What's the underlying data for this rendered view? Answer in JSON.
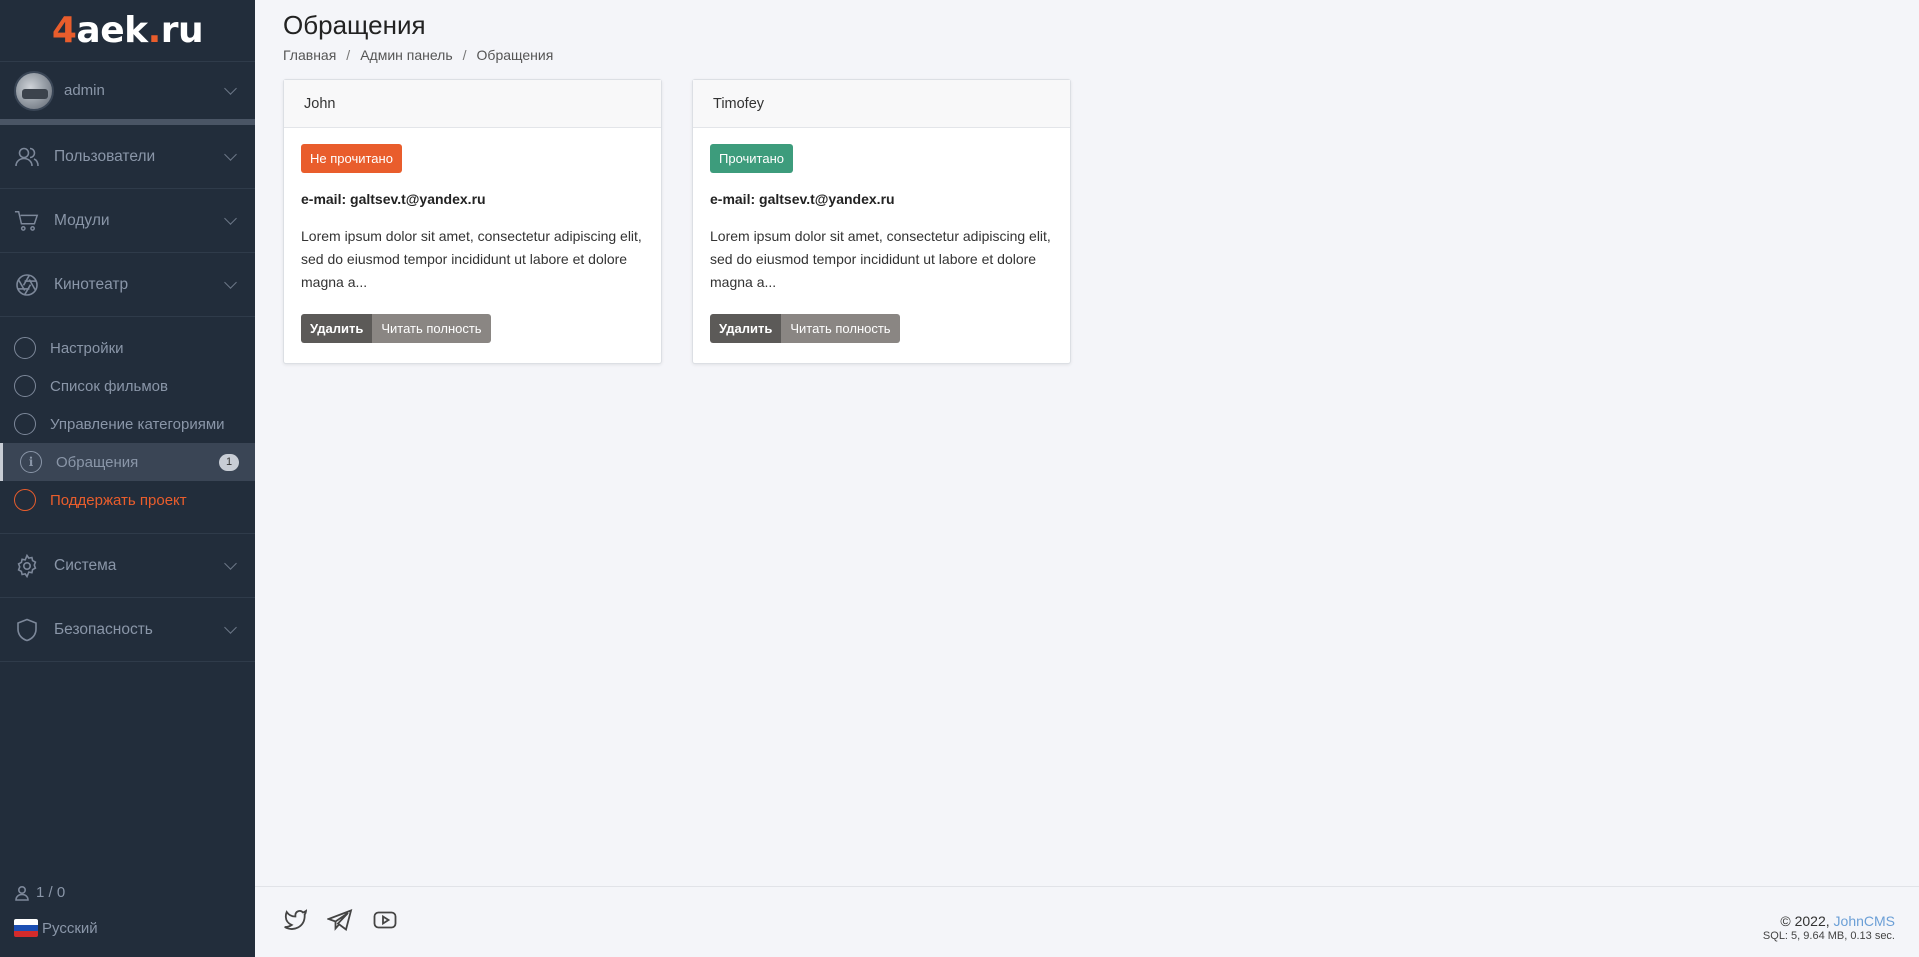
{
  "logo": {
    "part1": "4",
    "part2": "aek",
    "part3": ".",
    "part4": "ru"
  },
  "user": {
    "name": "admin"
  },
  "nav_groups_top": [
    {
      "label": "Пользователи",
      "icon": "users-icon"
    },
    {
      "label": "Модули",
      "icon": "cart-icon"
    },
    {
      "label": "Кинотеатр",
      "icon": "aperture-icon"
    }
  ],
  "nav_items": [
    {
      "label": "Настройки"
    },
    {
      "label": "Список фильмов"
    },
    {
      "label": "Управление категориями"
    },
    {
      "label": "Обращения",
      "badge": "1",
      "active": true
    },
    {
      "label": "Поддержать проект"
    }
  ],
  "nav_groups_bottom": [
    {
      "label": "Система",
      "icon": "gear-icon"
    },
    {
      "label": "Безопасность",
      "icon": "shield-icon"
    }
  ],
  "online": "1 / 0",
  "language": "Русский",
  "page": {
    "title": "Обращения",
    "breadcrumb": [
      "Главная",
      "Админ панель",
      "Обращения"
    ]
  },
  "cards": [
    {
      "name": "John",
      "status": "Не прочитано",
      "email": "e-mail: galtsev.t@yandex.ru",
      "message": "Lorem ipsum dolor sit amet, consectetur adipiscing elit, sed do eiusmod tempor incididunt ut labore et dolore magna a...",
      "delete_label": "Удалить",
      "read_label": "Читать полность"
    },
    {
      "name": "Timofey",
      "status": "Прочитано",
      "email": "e-mail: galtsev.t@yandex.ru",
      "message": "Lorem ipsum dolor sit amet, consectetur adipiscing elit, sed do eiusmod tempor incididunt ut labore et dolore magna a...",
      "delete_label": "Удалить",
      "read_label": "Читать полность"
    }
  ],
  "footer": {
    "copyright": "© 2022,",
    "cms_link": "JohnCMS",
    "stats": "SQL: 5, 9.64 MB, 0.13 sec."
  },
  "colors": {
    "sidebar_bg": "#222d3b",
    "accent": "#e95d2c",
    "read_status": "#3d9c7c",
    "link": "#6b9fd6"
  }
}
